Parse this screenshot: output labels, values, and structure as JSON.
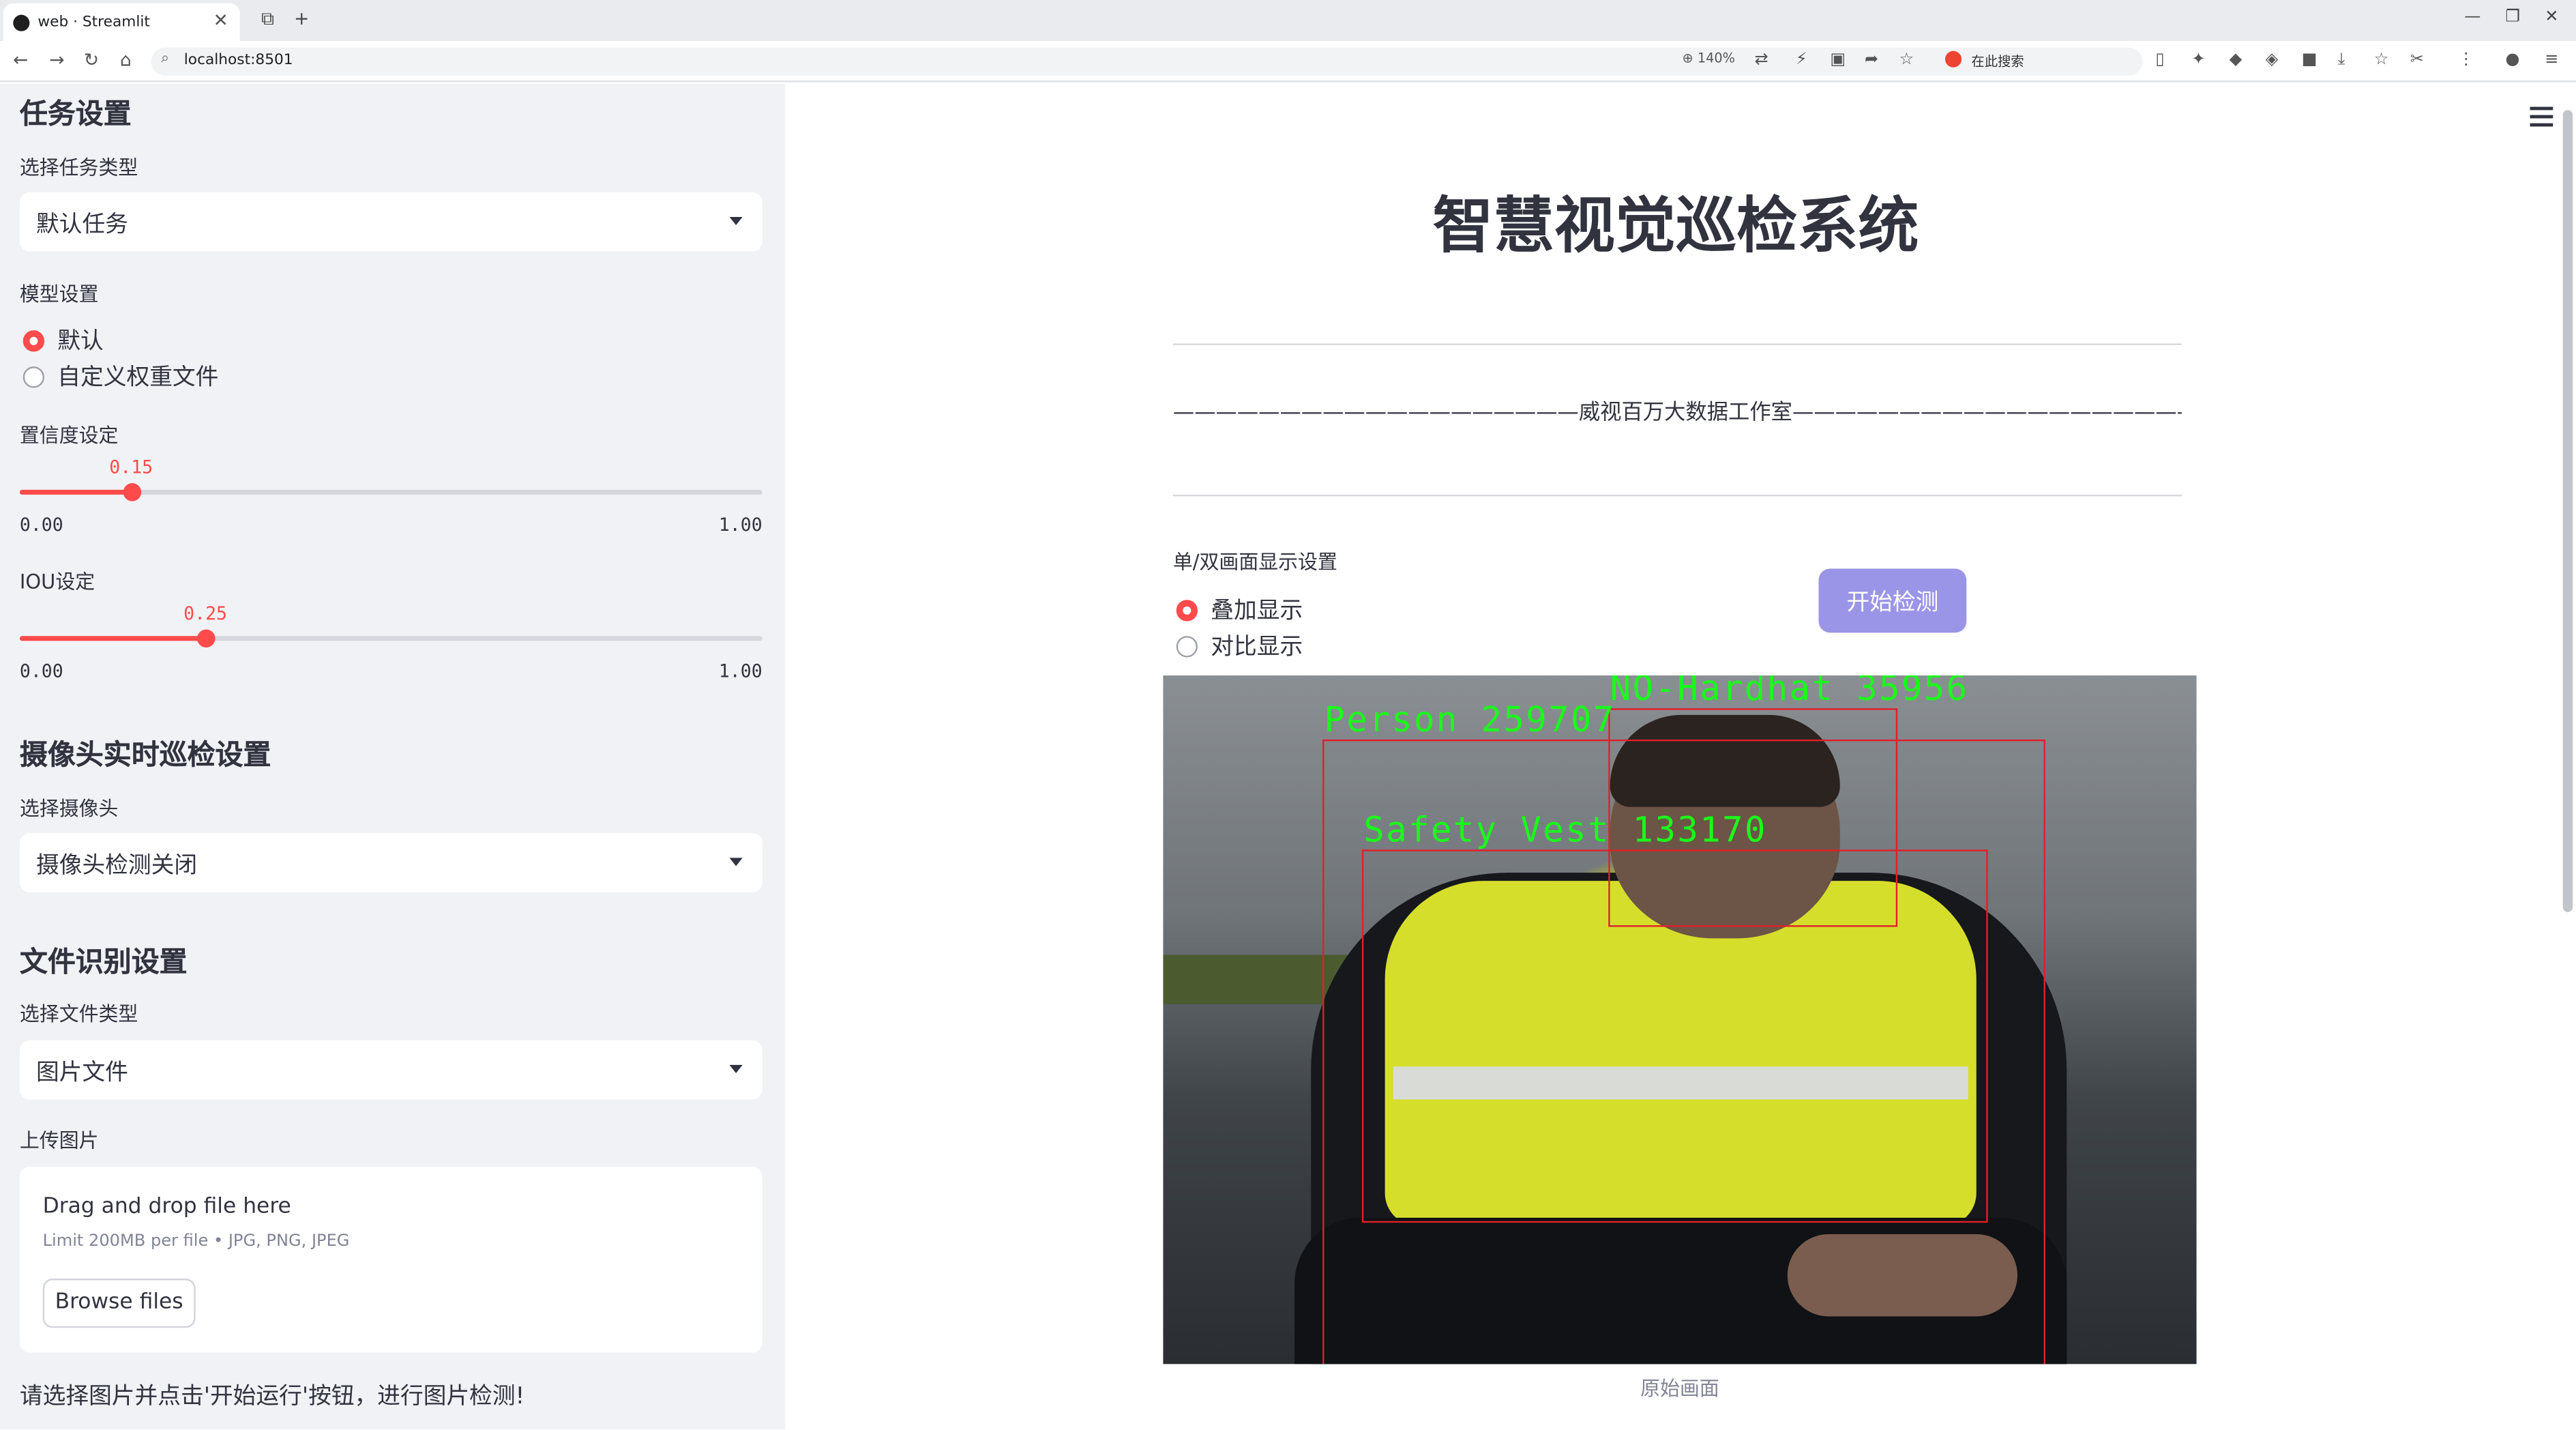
{
  "browser": {
    "tab_title": "web · Streamlit",
    "url": "localhost:8501",
    "zoom": "140%",
    "search_placeholder": "在此搜索"
  },
  "sidebar": {
    "task_section_title": "任务设置",
    "task_type_label": "选择任务类型",
    "task_type_value": "默认任务",
    "model_label": "模型设置",
    "model_options": [
      "默认",
      "自定义权重文件"
    ],
    "model_selected": 0,
    "confidence": {
      "label": "置信度设定",
      "value": "0.15",
      "fraction": 0.15,
      "min": "0.00",
      "max": "1.00"
    },
    "iou": {
      "label": "IOU设定",
      "value": "0.25",
      "fraction": 0.25,
      "min": "0.00",
      "max": "1.00"
    },
    "camera_section_title": "摄像头实时巡检设置",
    "camera_label": "选择摄像头",
    "camera_value": "摄像头检测关闭",
    "file_section_title": "文件识别设置",
    "file_type_label": "选择文件类型",
    "file_type_value": "图片文件",
    "upload_label": "上传图片",
    "dropzone_title": "Drag and drop file here",
    "dropzone_limit": "Limit 200MB per file • JPG, PNG, JPEG",
    "browse_label": "Browse files",
    "hint": "请选择图片并点击'开始运行'按钮，进行图片检测!"
  },
  "main": {
    "title": "智慧视觉巡检系统",
    "studio": "———————————————————威视百万大数据工作室————————————————————",
    "display_mode_label": "单/双画面显示设置",
    "display_options": [
      "叠加显示",
      "对比显示"
    ],
    "display_selected": 0,
    "start_button": "开始检测",
    "caption": "原始画面",
    "detections": [
      {
        "label": "NO-Hardhat 35956"
      },
      {
        "label": "Person 259707"
      },
      {
        "label": "Safety Vest 133170"
      }
    ]
  },
  "colors": {
    "accent": "#ff4b4b",
    "button": "#9b95e8",
    "box": "#e0202a",
    "box_label": "#19ff19"
  }
}
